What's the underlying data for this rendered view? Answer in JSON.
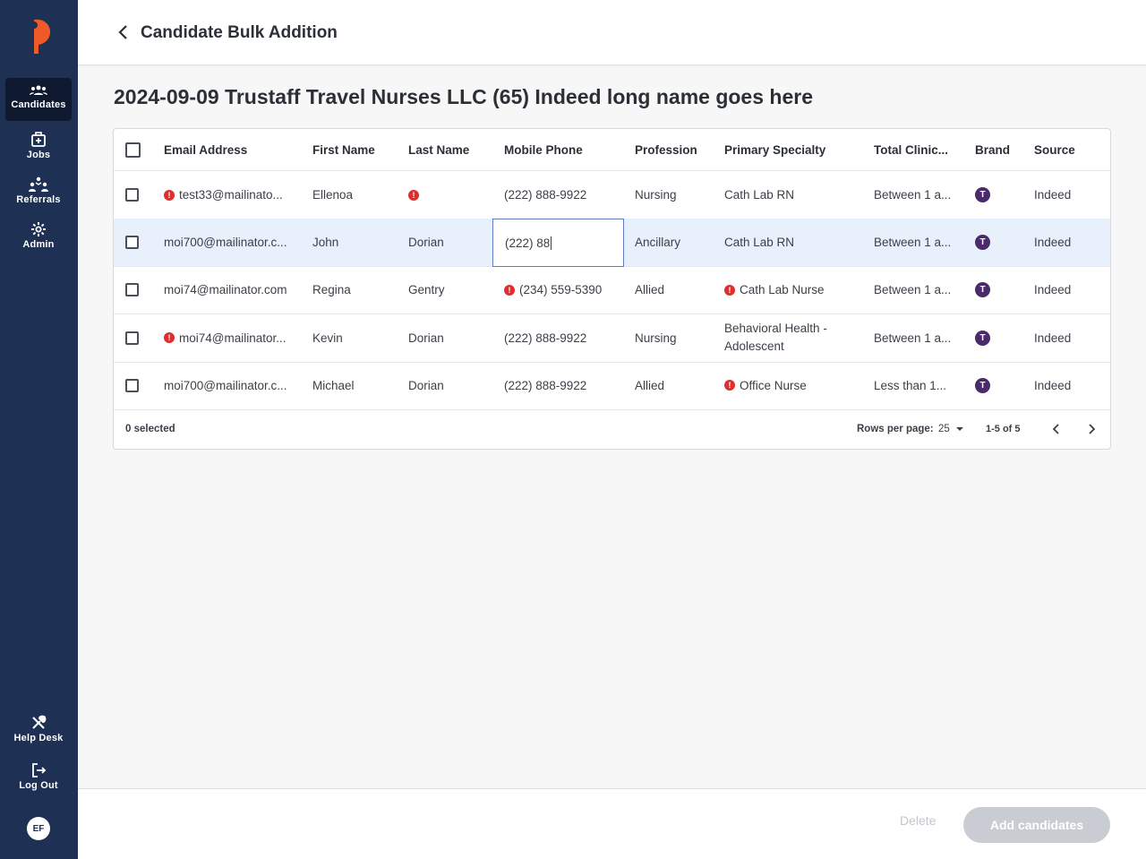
{
  "sidebar": {
    "nav": [
      {
        "label": "Candidates",
        "icon": "candidates-icon",
        "active": true
      },
      {
        "label": "Jobs",
        "icon": "jobs-icon"
      },
      {
        "label": "Referrals",
        "icon": "referrals-icon"
      },
      {
        "label": "Admin",
        "icon": "gear-icon"
      }
    ],
    "bottom": [
      {
        "label": "Help Desk",
        "icon": "tools-icon"
      },
      {
        "label": "Log Out",
        "icon": "logout-icon"
      }
    ],
    "avatar_initials": "EF"
  },
  "header": {
    "title": "Candidate Bulk Addition"
  },
  "page_title": "2024-09-09 Trustaff Travel Nurses LLC (65) Indeed long name goes here",
  "table": {
    "columns": [
      "Email Address",
      "First Name",
      "Last Name",
      "Mobile Phone",
      "Profession",
      "Primary Specialty",
      "Total Clinic...",
      "Brand",
      "Source"
    ],
    "rows": [
      {
        "email": "test33@mailinato...",
        "email_error": true,
        "first": "Ellenoa",
        "last": "",
        "last_error": true,
        "phone": "(222) 888-9922",
        "phone_error": false,
        "profession": "Nursing",
        "specialty": "Cath Lab RN",
        "specialty_error": false,
        "clinical": "Between 1 a...",
        "brand": "T",
        "source": "Indeed"
      },
      {
        "email": "moi700@mailinator.c...",
        "email_error": false,
        "first": "John",
        "last": "Dorian",
        "last_error": false,
        "phone": "(222) 88",
        "phone_editing": true,
        "profession": "Ancillary",
        "specialty": "Cath Lab RN",
        "specialty_error": false,
        "clinical": "Between 1 a...",
        "brand": "T",
        "source": "Indeed"
      },
      {
        "email": "moi74@mailinator.com",
        "email_error": false,
        "first": "Regina",
        "last": "Gentry",
        "last_error": false,
        "phone": "(234) 559-5390",
        "phone_error": true,
        "profession": "Allied",
        "specialty": "Cath Lab Nurse",
        "specialty_error": true,
        "clinical": "Between 1 a...",
        "brand": "T",
        "source": "Indeed"
      },
      {
        "email": "moi74@mailinator...",
        "email_error": true,
        "first": "Kevin",
        "last": "Dorian",
        "last_error": false,
        "phone": "(222) 888-9922",
        "phone_error": false,
        "profession": "Nursing",
        "specialty": "Behavioral Health - Adolescent",
        "specialty_error": false,
        "clinical": "Between 1 a...",
        "brand": "T",
        "source": "Indeed"
      },
      {
        "email": "moi700@mailinator.c...",
        "email_error": false,
        "first": "Michael",
        "last": "Dorian",
        "last_error": false,
        "phone": "(222) 888-9922",
        "phone_error": false,
        "profession": "Allied",
        "specialty": "Office Nurse",
        "specialty_error": true,
        "clinical": "Less than 1...",
        "brand": "T",
        "source": "Indeed"
      }
    ],
    "footer": {
      "selected": "0 selected",
      "rows_per_page_label": "Rows per page:",
      "rows_per_page": "25",
      "range": "1-5 of 5"
    }
  },
  "actions": {
    "delete": "Delete",
    "add": "Add candidates"
  },
  "colors": {
    "sidebar": "#1e3054",
    "accent_orange": "#f05a28",
    "error": "#e02d2d",
    "brand": "#4a2a6b",
    "selected_row": "#e7f0fb"
  }
}
